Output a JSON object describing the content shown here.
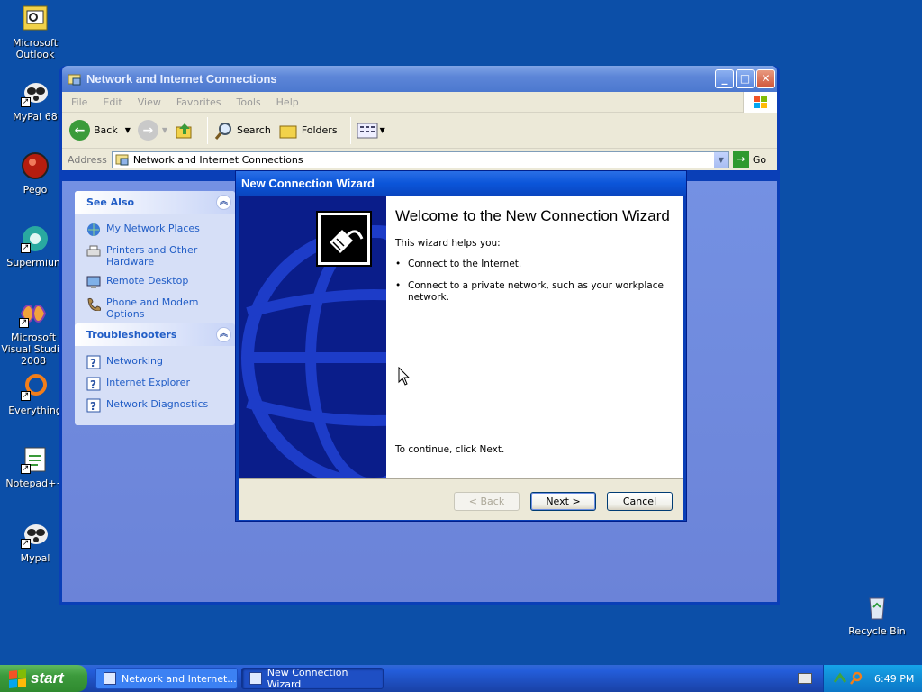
{
  "desktop": {
    "icons": [
      {
        "label": "Microsoft Outlook"
      },
      {
        "label": "MyPal 68"
      },
      {
        "label": "Pego"
      },
      {
        "label": "Supermium"
      },
      {
        "label": "Microsoft Visual Studio 2008"
      },
      {
        "label": "Everything"
      },
      {
        "label": "Notepad++"
      },
      {
        "label": "Mypal"
      },
      {
        "label": "Recycle Bin"
      }
    ]
  },
  "explorer": {
    "title": "Network and Internet Connections",
    "menu": [
      "File",
      "Edit",
      "View",
      "Favorites",
      "Tools",
      "Help"
    ],
    "toolbar": {
      "back": "Back",
      "search": "Search",
      "folders": "Folders"
    },
    "address": {
      "label": "Address",
      "value": "Network and Internet Connections",
      "go": "Go"
    },
    "see_also": {
      "title": "See Also",
      "items": [
        "My Network Places",
        "Printers and Other Hardware",
        "Remote Desktop",
        "Phone and Modem Options"
      ]
    },
    "troubleshooters": {
      "title": "Troubleshooters",
      "items": [
        "Networking",
        "Internet Explorer",
        "Network Diagnostics"
      ]
    }
  },
  "wizard": {
    "title": "New Connection Wizard",
    "heading": "Welcome to the New Connection Wizard",
    "intro": "This wizard helps you:",
    "bullets": [
      "Connect to the Internet.",
      "Connect to a private network, such as your workplace network."
    ],
    "continue": "To continue, click Next.",
    "buttons": {
      "back": "< Back",
      "next": "Next >",
      "cancel": "Cancel"
    }
  },
  "taskbar": {
    "start": "start",
    "tasks": [
      "Network and Internet...",
      "New Connection Wizard"
    ],
    "clock": "6:49 PM"
  }
}
